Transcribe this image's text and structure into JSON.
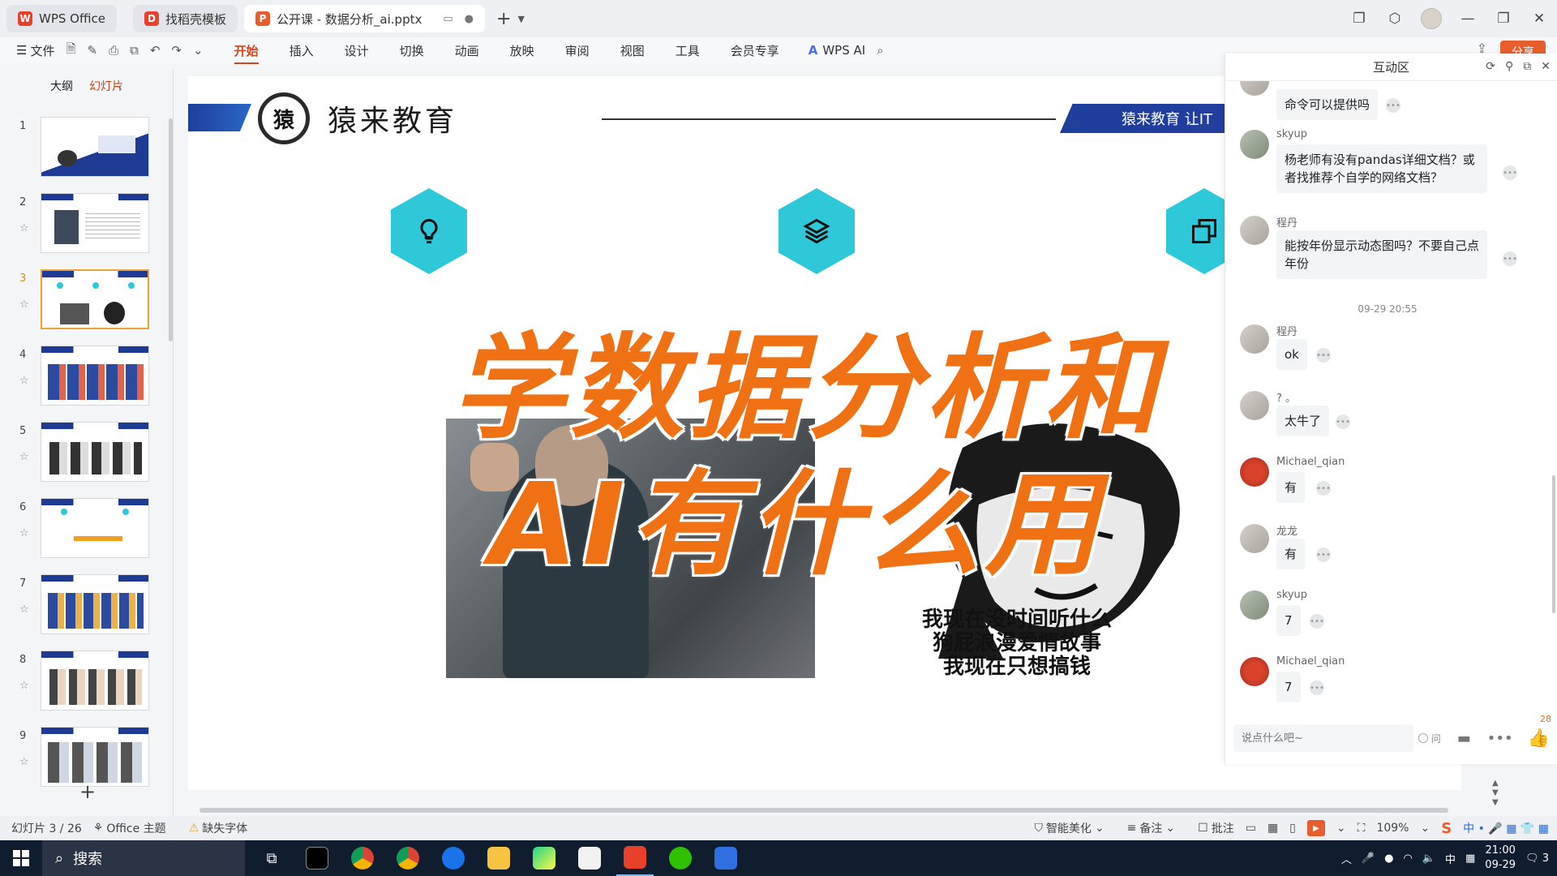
{
  "titlebar": {
    "tabs": [
      {
        "label": "WPS Office",
        "logo": "W",
        "color": "#e8402b"
      },
      {
        "label": "找稻壳模板",
        "logo": "D",
        "color": "#e8402b"
      },
      {
        "label": "公开课 - 数据分析_ai.pptx",
        "logo": "P",
        "color": "#e85d2c"
      }
    ]
  },
  "ribbon": {
    "file": "文件",
    "tabs": [
      "开始",
      "插入",
      "设计",
      "切换",
      "动画",
      "放映",
      "审阅",
      "视图",
      "工具",
      "会员专享"
    ],
    "active_tab": "开始",
    "wps_ai": "WPS AI",
    "share": "分享"
  },
  "left_panel": {
    "tab_outline": "大纲",
    "tab_slides": "幻灯片",
    "slide_numbers": [
      "1",
      "2",
      "3",
      "4",
      "5",
      "6",
      "7",
      "8",
      "9"
    ],
    "selected": 3
  },
  "slide": {
    "brand": "猿来教育",
    "logo_char": "猿",
    "banner": "猿来教育 让IT",
    "title_line1": "学数据分析和",
    "title_line2": "AI有什么用",
    "meme_caption": [
      "我现在没时间听什么",
      "狗屁浪漫爱情故事",
      "我现在只想搞钱"
    ]
  },
  "chat": {
    "title": "互动区",
    "messages": [
      {
        "name": "",
        "text": "命令可以提供吗"
      },
      {
        "name": "skyup",
        "text": "杨老师有没有pandas详细文档？或者找推荐个自学的网络文档？"
      },
      {
        "name": "程丹",
        "text": "能按年份显示动态图吗？不要自己点年份"
      },
      {
        "name": "程丹",
        "text": "ok"
      },
      {
        "name": "? 。",
        "text": "太牛了"
      },
      {
        "name": "Michael_qian",
        "text": "有"
      },
      {
        "name": "龙龙",
        "text": "有"
      },
      {
        "name": "skyup",
        "text": "7"
      },
      {
        "name": "Michael_qian",
        "text": "7"
      }
    ],
    "timestamp": "09-29 20:55",
    "input_placeholder": "说点什么吧~",
    "ask_label": "问",
    "like_count": "28"
  },
  "statusbar": {
    "slide_pos": "幻灯片 3 / 26",
    "theme": "Office 主题",
    "missing_font": "缺失字体",
    "beautify": "智能美化",
    "notes": "备注",
    "comments": "批注",
    "zoom": "109%"
  },
  "taskbar": {
    "search": "搜索",
    "time": "21:00",
    "date": "09-29",
    "ime": "中",
    "notif_count": "3"
  }
}
